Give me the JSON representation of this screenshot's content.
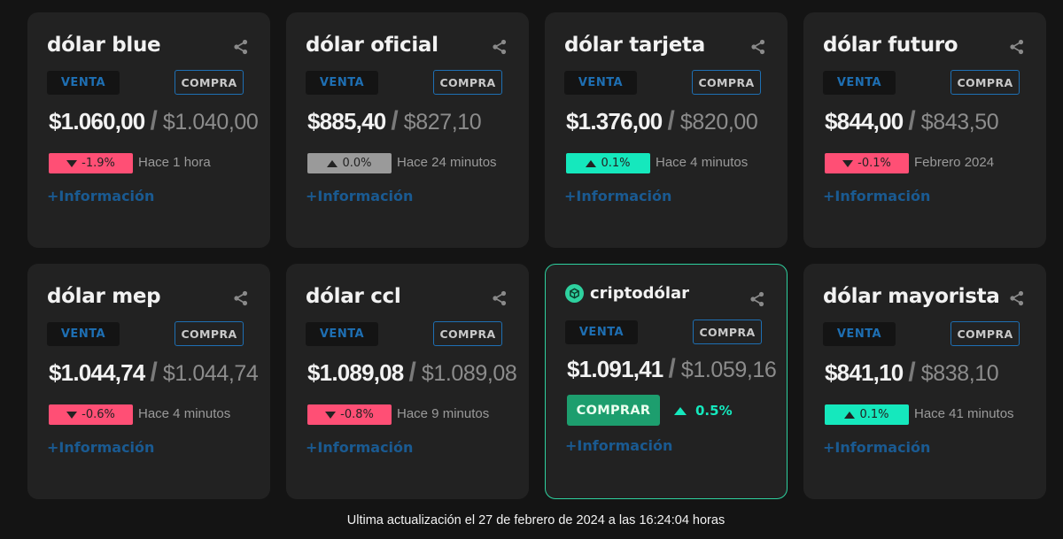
{
  "labels": {
    "venta": "VENTA",
    "compra": "COMPRA",
    "info": "+Información",
    "sep": "/"
  },
  "cards": [
    {
      "title": "dólar blue",
      "venta": "$1.060,00",
      "compra": "$1.040,00",
      "change": "-1.9%",
      "direction": "down",
      "time": "Hace 1 hora"
    },
    {
      "title": "dólar oficial",
      "venta": "$885,40",
      "compra": "$827,10",
      "change": "0.0%",
      "direction": "flat",
      "time": "Hace 24 minutos"
    },
    {
      "title": "dólar tarjeta",
      "venta": "$1.376,00",
      "compra": "$820,00",
      "change": "0.1%",
      "direction": "up",
      "time": "Hace 4 minutos"
    },
    {
      "title": "dólar futuro",
      "venta": "$844,00",
      "compra": "$843,50",
      "change": "-0.1%",
      "direction": "down",
      "time": "Febrero 2024"
    },
    {
      "title": "dólar mep",
      "venta": "$1.044,74",
      "compra": "$1.044,74",
      "change": "-0.6%",
      "direction": "down",
      "time": "Hace 4 minutos"
    },
    {
      "title": "dólar ccl",
      "venta": "$1.089,08",
      "compra": "$1.089,08",
      "change": "-0.8%",
      "direction": "down",
      "time": "Hace 9 minutos"
    },
    {
      "title": "dólar mayorista",
      "venta": "$841,10",
      "compra": "$838,10",
      "change": "0.1%",
      "direction": "up",
      "time": "Hace 41 minutos"
    }
  ],
  "crypto": {
    "title": "criptodólar",
    "venta": "$1.091,41",
    "compra": "$1.059,16",
    "buy_label": "COMPRAR",
    "change": "0.5%",
    "icon": "cube-icon"
  },
  "colors": {
    "background": "#141414",
    "card": "#222222",
    "accent_blue": "#1e6fb3",
    "down": "#ff4f75",
    "up": "#15e8bd",
    "flat": "#9a9a9a",
    "crypto_border": "#2ed19f",
    "buy_button": "#1d9e6e"
  },
  "footer": {
    "text": "Ultima actualización el 27 de febrero de 2024 a las 16:24:04 horas"
  }
}
